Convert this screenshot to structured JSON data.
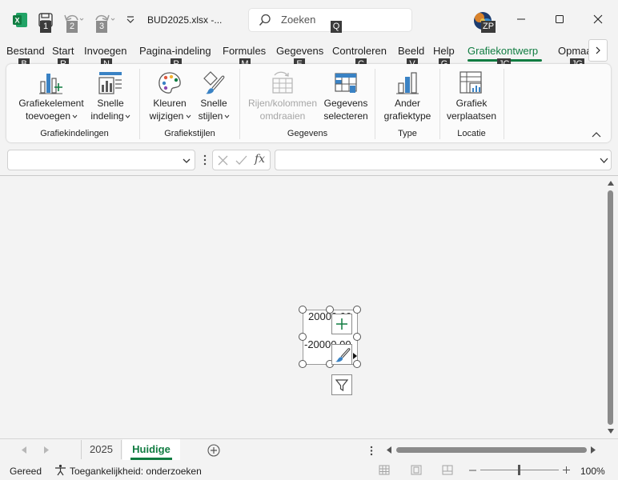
{
  "titlebar": {
    "filename": "BUD2025.xlsx  -...",
    "search_placeholder": "Zoeken",
    "search_keytip": "Q",
    "user_initials_keytip": "ZP",
    "qat_keytips": [
      "1",
      "2",
      "3"
    ]
  },
  "tabs": [
    {
      "label": "Bestand",
      "keytip": "B"
    },
    {
      "label": "Start",
      "keytip": "R"
    },
    {
      "label": "Invoegen",
      "keytip": "N"
    },
    {
      "label": "Pagina-indeling",
      "keytip": "P"
    },
    {
      "label": "Formules",
      "keytip": "M"
    },
    {
      "label": "Gegevens",
      "keytip": "E"
    },
    {
      "label": "Controleren",
      "keytip": "C"
    },
    {
      "label": "Beeld",
      "keytip": "V"
    },
    {
      "label": "Help",
      "keytip": "G"
    },
    {
      "label": "Grafiekontwerp",
      "keytip": "JC"
    },
    {
      "label": "Opmaak",
      "keytip": "JG"
    }
  ],
  "ribbon": {
    "buttons": {
      "add_element": [
        "Grafiekelement",
        "toevoegen"
      ],
      "quick_layout": [
        "Snelle",
        "indeling"
      ],
      "change_colors": [
        "Kleuren",
        "wijzigen"
      ],
      "quick_styles": [
        "Snelle",
        "stijlen"
      ],
      "switch_rowcol": [
        "Rijen/kolommen",
        "omdraaien"
      ],
      "select_data": [
        "Gegevens",
        "selecteren"
      ],
      "change_type": [
        "Ander",
        "grafiektype"
      ],
      "move_chart": [
        "Grafiek",
        "verplaatsen"
      ]
    },
    "groups": {
      "layouts": "Grafiekindelingen",
      "styles": "Grafiekstijlen",
      "data": "Gegevens",
      "type": "Type",
      "location": "Locatie"
    }
  },
  "formula_bar": {
    "fx": "fx",
    "name_box": "",
    "formula": ""
  },
  "chart": {
    "label_top": "20000,00",
    "label_bottom": "-20000,00"
  },
  "sheet_tabs": [
    "2025",
    "Huidige"
  ],
  "status": {
    "ready": "Gereed",
    "accessibility": "Toegankelijkheid: onderzoeken",
    "zoom": "100%"
  }
}
